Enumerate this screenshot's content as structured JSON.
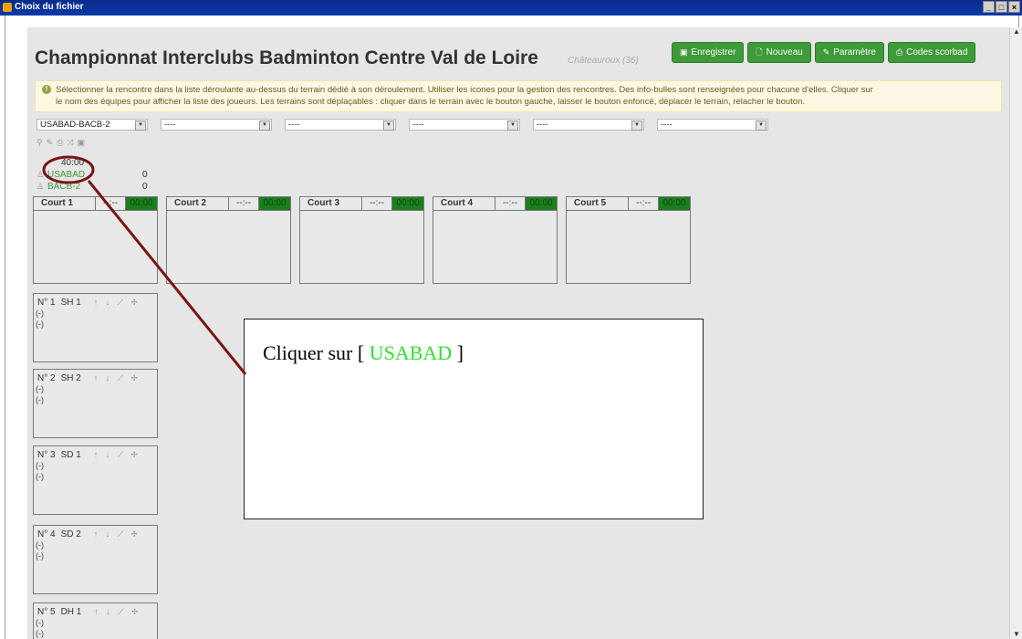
{
  "window": {
    "title": "Choix du fichier",
    "controls": [
      "_",
      "□",
      "×"
    ]
  },
  "header": {
    "title": "Championnat Interclubs Badminton Centre Val de Loire",
    "subtitle": "Châteauroux (36)"
  },
  "toolbar": {
    "buttons": [
      {
        "label": "Enregistrer",
        "icon": "save-icon",
        "glyph": "▣"
      },
      {
        "label": "Nouveau",
        "icon": "new-file-icon",
        "glyph": "🗋"
      },
      {
        "label": "Paramètre",
        "icon": "wrench-icon",
        "glyph": "✎"
      },
      {
        "label": "Codes scorbad",
        "icon": "print-icon",
        "glyph": "⎙"
      }
    ],
    "color": "#3f9a3a"
  },
  "info": {
    "line1": "Sélectionner la rencontre dans la liste déroulante au-dessus du terrain dédié à son déroulement. Utiliser les icones pour la gestion des rencontres. Des info-bulles sont renseignées pour chacune d'elles. Cliquer sur",
    "line2": "le nom des équipes pour afficher la liste des joueurs. Les terrains sont déplaçables : cliquer dans le terrain avec le bouton gauche, laisser le bouton enfoncé, déplacer le terrain, relacher le bouton."
  },
  "selects": [
    {
      "value": "USABAD-BACB-2"
    },
    {
      "value": "----"
    },
    {
      "value": "----"
    },
    {
      "value": "----"
    },
    {
      "value": "----"
    },
    {
      "value": "----"
    }
  ],
  "icons_row": [
    "bulb-icon",
    "pencil-icon",
    "print-icon",
    "shuffle-icon",
    "image-icon"
  ],
  "match_header": {
    "timer": "40:00",
    "teams": [
      {
        "name": "USABAD",
        "score": "0"
      },
      {
        "name": "BACB-2",
        "score": "0"
      }
    ]
  },
  "courts": [
    {
      "name": "Court 1",
      "status": "--:--",
      "time": "00:00"
    },
    {
      "name": "Court 2",
      "status": "--:--",
      "time": "00:00"
    },
    {
      "name": "Court 3",
      "status": "--:--",
      "time": "00:00"
    },
    {
      "name": "Court 4",
      "status": "--:--",
      "time": "00:00"
    },
    {
      "name": "Court 5",
      "status": "--:--",
      "time": "00:00"
    }
  ],
  "matches": [
    {
      "num": "N° 1",
      "type": "SH 1",
      "p1": "(-)",
      "p2": "(-)"
    },
    {
      "num": "N° 2",
      "type": "SH 2",
      "p1": "(-)",
      "p2": "(-)"
    },
    {
      "num": "N° 3",
      "type": "SD 1",
      "p1": "(-)",
      "p2": "(-)"
    },
    {
      "num": "N° 4",
      "type": "SD 2",
      "p1": "(-)",
      "p2": "(-)"
    },
    {
      "num": "N° 5",
      "type": "DH 1",
      "p1": "(-)",
      "p2": "(-)"
    }
  ],
  "match_icons": "↑ ↓ ⟋ ✢",
  "callout": {
    "prefix": "Cliquer sur [ ",
    "highlight": "USABAD",
    "suffix": " ]"
  }
}
